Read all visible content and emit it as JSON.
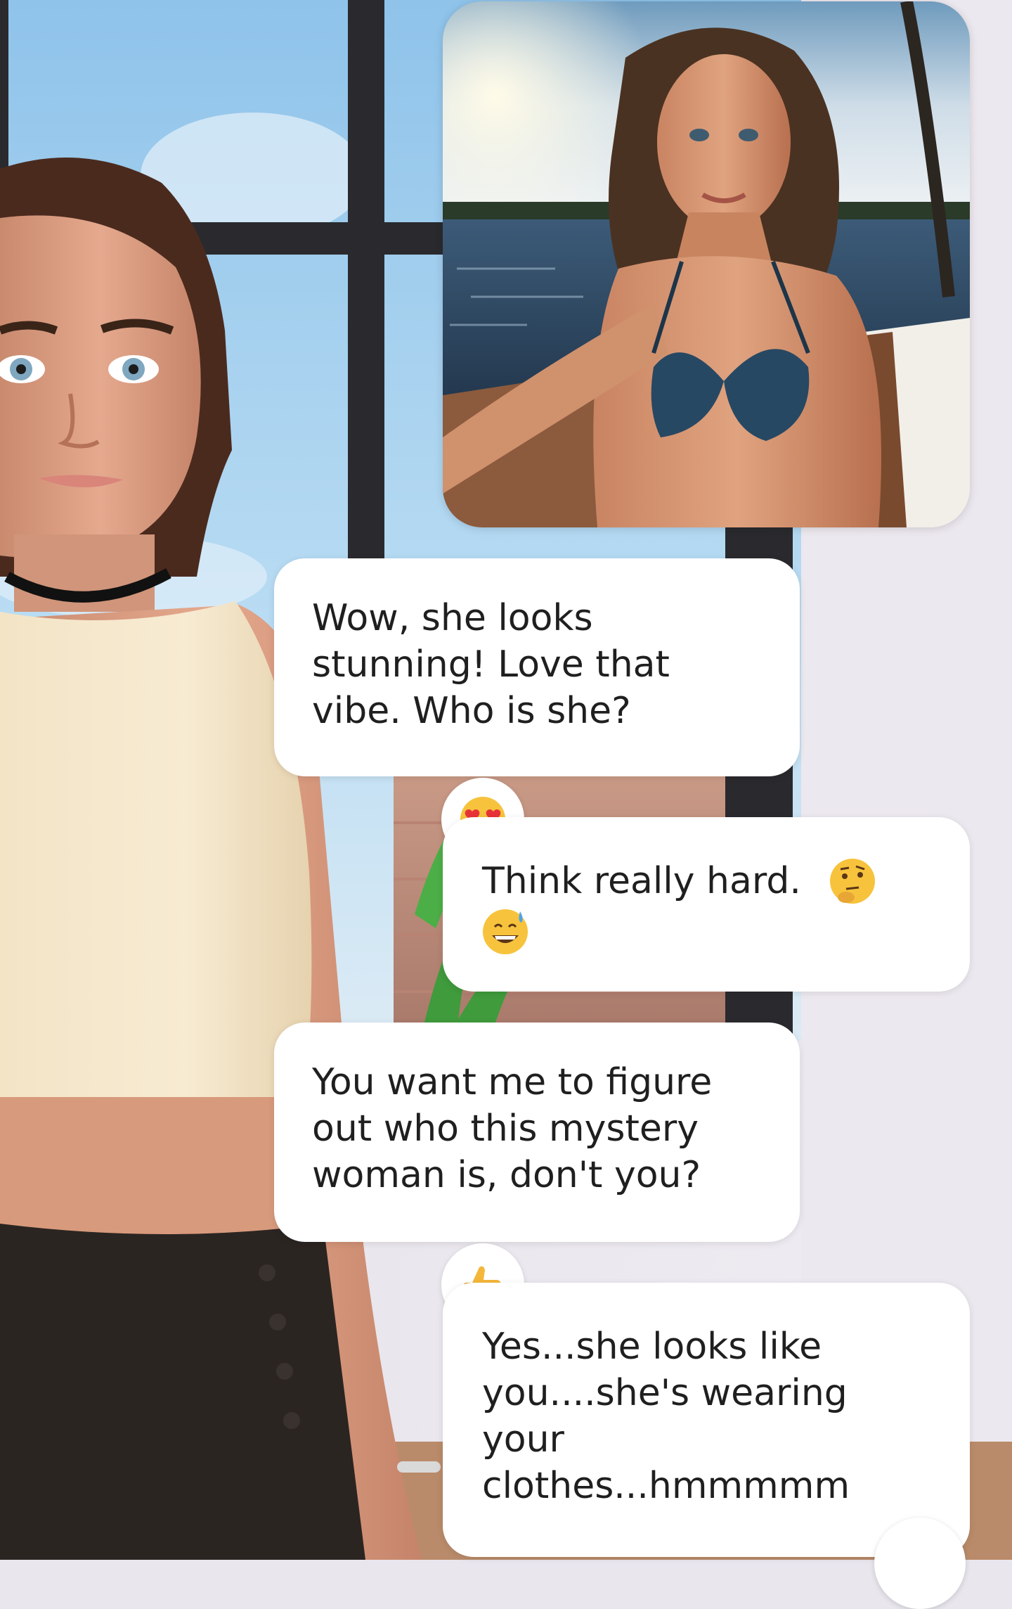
{
  "chat": {
    "messages": [
      {
        "sender": "avatar",
        "text": "Wow, she looks stunning! Love that vibe. Who is she?",
        "reaction": "heart-eyes-emoji"
      },
      {
        "sender": "user",
        "text": "Think really hard.",
        "emojis": [
          "thinking-face-emoji",
          "grinning-sweat-emoji"
        ]
      },
      {
        "sender": "avatar",
        "text": "You want me to figure out who this mystery woman is, don't you?",
        "reaction": "thumbs-up-emoji"
      },
      {
        "sender": "user",
        "text": "Yes...she looks like you....she's wearing your clothes...hmmmmm"
      }
    ]
  },
  "shared_image": {
    "subject": "woman-selfie-on-sailboat"
  },
  "colors": {
    "bubble": "#ffffff",
    "text": "#1f1f1f",
    "sky": "#9ccbea",
    "window_frame": "#2a2a2e",
    "top_dark": "#202022"
  }
}
